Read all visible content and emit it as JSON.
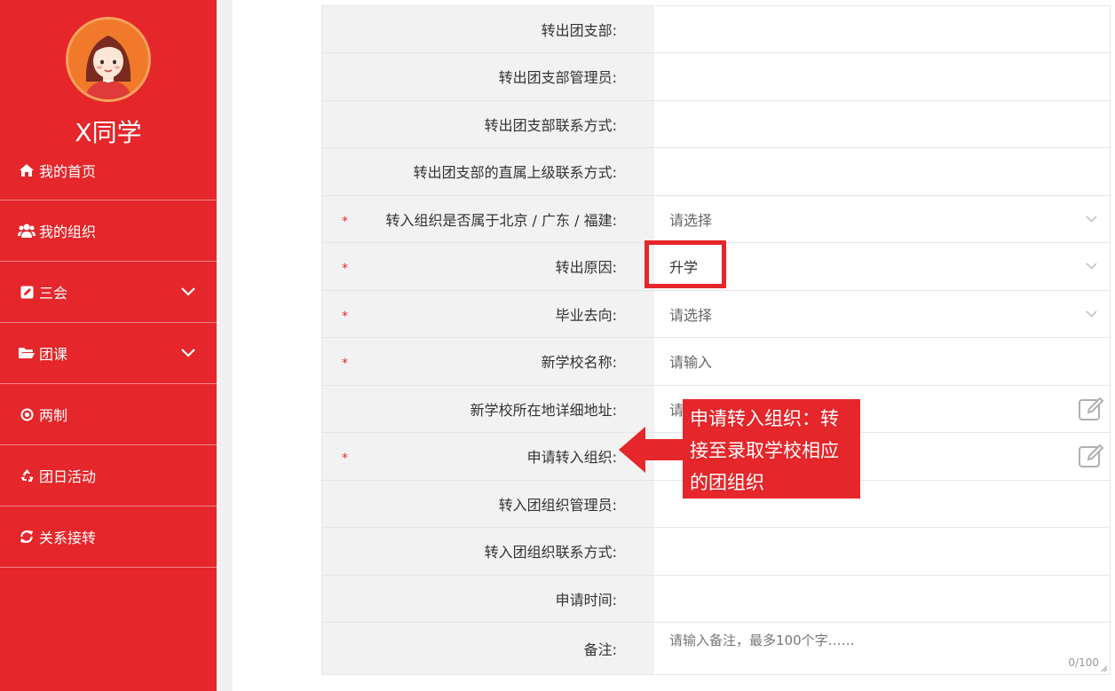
{
  "user": {
    "name": "X同学"
  },
  "nav": [
    {
      "icon": "home-icon",
      "label": "我的首页",
      "expandable": false
    },
    {
      "icon": "users-icon",
      "label": "我的组织",
      "expandable": false
    },
    {
      "icon": "edit-icon",
      "label": "三会",
      "expandable": true
    },
    {
      "icon": "folder-open-icon",
      "label": "团课",
      "expandable": true
    },
    {
      "icon": "dot-circle-icon",
      "label": "两制",
      "expandable": false
    },
    {
      "icon": "recycle-icon",
      "label": "团日活动",
      "expandable": false
    },
    {
      "icon": "refresh-icon",
      "label": "关系接转",
      "expandable": false
    }
  ],
  "form": {
    "out_branch_label": "转出团支部:",
    "out_admin_label": "转出团支部管理员:",
    "out_contact_label": "转出团支部联系方式:",
    "out_superior_contact_label": "转出团支部的直属上级联系方式:",
    "region_label": "转入组织是否属于北京 / 广东 / 福建:",
    "region_placeholder": "请选择",
    "reason_label": "转出原因:",
    "reason_value": "升学",
    "destination_label": "毕业去向:",
    "destination_placeholder": "请选择",
    "new_school_label": "新学校名称:",
    "new_school_placeholder": "请输入",
    "school_address_label": "新学校所在地详细地址:",
    "school_address_placeholder": "请",
    "apply_org_label": "申请转入组织:",
    "in_admin_label": "转入团组织管理员:",
    "in_contact_label": "转入团组织联系方式:",
    "apply_time_label": "申请时间:",
    "remark_label": "备注:",
    "remark_placeholder": "请输入备注，最多100个字……",
    "remark_counter": "0/100",
    "required_mark": "*"
  },
  "annotation": {
    "callout_text": "申请转入组织：转接至录取学校相应的团组织"
  },
  "colors": {
    "sidebar": "#e5262a",
    "accent": "#e5262a",
    "label_bg": "#f2f2f2"
  }
}
